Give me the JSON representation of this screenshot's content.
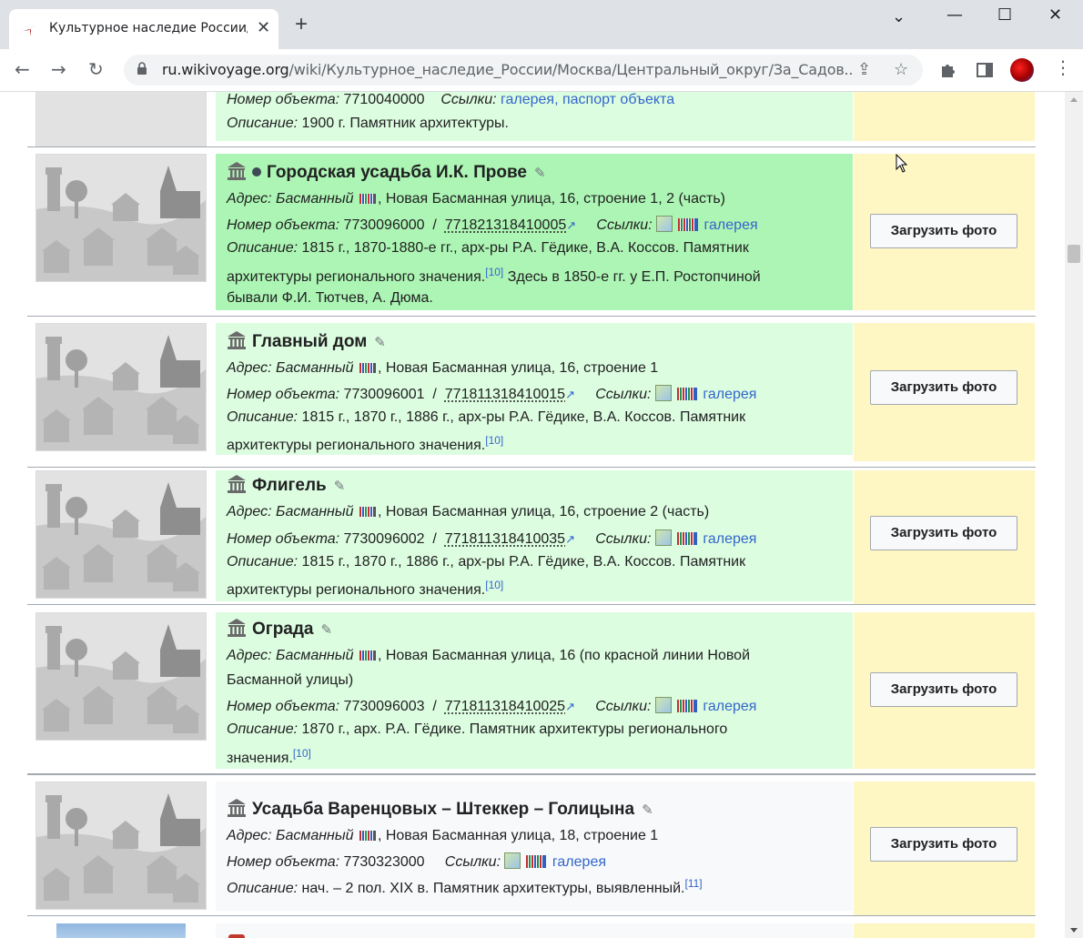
{
  "browser": {
    "tab_title": "Культурное наследие России/М",
    "url_host": "ru.wikivoyage.org",
    "url_path": "/wiki/Культурное_наследие_России/Москва/Центральный_округ/За_Садов...",
    "window_controls": [
      "minimize",
      "maximize",
      "close"
    ],
    "icons": [
      "back-icon",
      "forward-icon",
      "reload-icon",
      "lock-icon",
      "share-icon",
      "star-icon",
      "extensions-icon",
      "sidepanel-icon",
      "menu-icon"
    ]
  },
  "labels": {
    "address": "Адрес:",
    "object_number": "Номер объекта:",
    "links": "Ссылки:",
    "description": "Описание:",
    "gallery": "галерея",
    "upload_button": "Загрузить фото"
  },
  "top_row": {
    "obj_partial": "7710040000",
    "links_partial": "галерея, паспорт объекта",
    "description": "1900 г. Памятник архитектуры."
  },
  "rows": [
    {
      "title": "Городская усадьба И.К. Прове",
      "district": "Басманный",
      "address": ", Новая Басманная улица, 16, строение 1, 2 (часть)",
      "number": "7730096000",
      "uid": "771821318410005",
      "desc_1": "1815 г., 1870-1880-е гг., арх-ры Р.А. Гёдике, В.А. Коссов. Памятник",
      "desc_2": "архитектуры регионального значения.",
      "ref": "[10]",
      "desc_2b": " Здесь в 1850-е гг. у Е.П. Ростопчиной",
      "desc_3": "бывали Ф.И. Тютчев, А. Дюма."
    },
    {
      "title": "Главный дом",
      "district": "Басманный",
      "address": ", Новая Басманная улица, 16, строение 1",
      "number": "7730096001",
      "uid": "771811318410015",
      "desc_1": "1815 г., 1870 г., 1886 г., арх-ры Р.А. Гёдике, В.А. Коссов. Памятник",
      "desc_2": "архитектуры регионального значения.",
      "ref": "[10]"
    },
    {
      "title": "Флигель",
      "district": "Басманный",
      "address": ", Новая Басманная улица, 16, строение 2 (часть)",
      "number": "7730096002",
      "uid": "771811318410035",
      "desc_1": "1815 г., 1870 г., 1886 г., арх-ры Р.А. Гёдике, В.А. Коссов. Памятник",
      "desc_2": "архитектуры регионального значения.",
      "ref": "[10]"
    },
    {
      "title": "Ограда",
      "district": "Басманный",
      "address": ", Новая Басманная улица, 16 (по красной линии Новой",
      "address_2": "Басманной улицы)",
      "number": "7730096003",
      "uid": "771811318410025",
      "desc_1": "1870 г., арх. Р.А. Гёдике. Памятник архитектуры регионального",
      "desc_2": "значения.",
      "ref": "[10]"
    },
    {
      "title": "Усадьба Варенцовых – Штеккер – Голицына",
      "district": "Басманный",
      "address": ", Новая Басманная улица, 18, строение 1",
      "number": "7730323000",
      "desc_1": "нач. – 2 пол. XIX в. Памятник архитектуры, выявленный.",
      "ref": "[11]"
    }
  ],
  "colors": {
    "highlight_green": "#adf5b4",
    "light_green": "#ddfde0",
    "light_gray": "#f8f9fa",
    "button_column_yellow": "#fef6c3",
    "link_blue": "#3366cc"
  }
}
